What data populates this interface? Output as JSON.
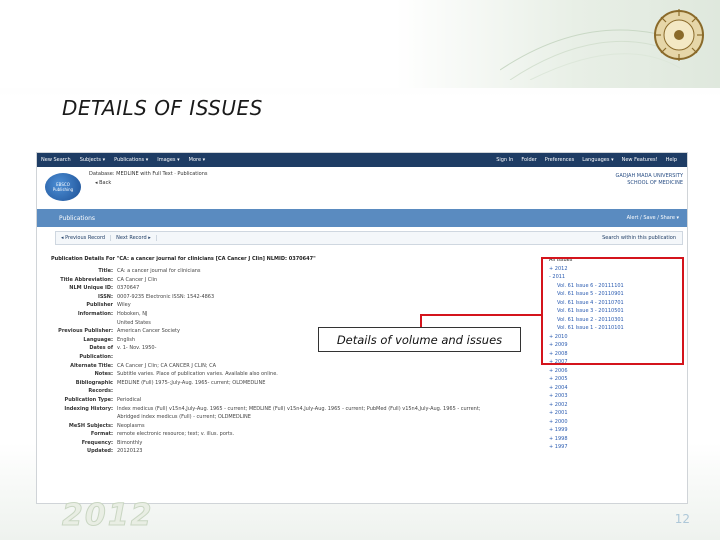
{
  "slide": {
    "title": "DETAILS OF ISSUES",
    "year": "2012",
    "page_number": "12",
    "callout_text": "Details of volume and issues",
    "colors": {
      "annotation": "#d4141c",
      "title": "#1a1a1a",
      "nav": "#1e3c64",
      "bar": "#5a8bc0"
    }
  },
  "screenshot": {
    "topnav": {
      "left": [
        "New Search",
        "Subjects ▾",
        "Publications ▾",
        "Images ▾",
        "More ▾"
      ],
      "right": [
        "Sign In",
        "Folder",
        "Preferences",
        "Languages ▾",
        "New Features!",
        "Help"
      ]
    },
    "header": {
      "logo_top": "EBSCO",
      "logo_bottom": "Publishing",
      "database_line": "Database: MEDLINE with Full Text · Publications",
      "back": "◂ Back",
      "university": [
        "GADJAH MADA UNIVERSITY",
        "SCHOOL OF MEDICINE"
      ]
    },
    "pub_bar": {
      "label": "Publications",
      "tools": "Alert / Save / Share ▾"
    },
    "pager": {
      "prev": "◂ Previous Record",
      "next": "Next Record ▸",
      "search": "Search within this publication"
    },
    "details_title": "Publication Details For \"CA: a cancer journal for clinicians [CA Cancer J Clin] NLMID: 0370647\"",
    "details": [
      {
        "label": "Title:",
        "value": "CA: a cancer journal for clinicians"
      },
      {
        "label": "Title Abbreviation:",
        "value": "CA Cancer J Clin"
      },
      {
        "label": "NLM Unique ID:",
        "value": "0370647"
      },
      {
        "label": "ISSN:",
        "value": "0007-9235 Electronic ISSN: 1542-4863"
      },
      {
        "label": "Publisher",
        "value": "Wiley"
      },
      {
        "label": "Information:",
        "value": "Hoboken, NJ"
      },
      {
        "label": "",
        "value": "United States"
      },
      {
        "label": "Previous Publisher:",
        "value": "American Cancer Society"
      },
      {
        "label": "Language:",
        "value": "English"
      },
      {
        "label": "Dates of",
        "value": "v. 1- Nov. 1950-"
      },
      {
        "label": "Publication:",
        "value": ""
      },
      {
        "label": "Alternate Title:",
        "value": "CA Cancer J Clin; CA CANCER J CLIN; CA"
      },
      {
        "label": "Notes:",
        "value": "Subtitle varies. Place of publication varies. Available also online."
      },
      {
        "label": "Bibliographic",
        "value": "MEDLINE (Full) 1975-;July-Aug. 1965- current; OLDMEDLINE"
      },
      {
        "label": "Records:",
        "value": ""
      },
      {
        "label": "Publication Type:",
        "value": "Periodical"
      },
      {
        "label": "Indexing History:",
        "value": "Index medicus (Full) v15n4,July-Aug. 1965 - current; MEDLINE (Full) v15n4,July-Aug. 1965 - current; PubMed (Full) v15n4,July-Aug. 1965 - current;"
      },
      {
        "label": "",
        "value": "Abridged index medicus (Full) - current; OLDMEDLINE"
      },
      {
        "label": "MeSH Subjects:",
        "value": "Neoplasms"
      },
      {
        "label": "Format:",
        "value": "remote electronic resource; text; v. illus. ports."
      },
      {
        "label": "Frequency:",
        "value": "Bimonthly"
      },
      {
        "label": "Updated:",
        "value": "20120123"
      }
    ],
    "issues": [
      {
        "text": "All Issues",
        "sub": false,
        "head": true
      },
      {
        "text": "+ 2012",
        "sub": false
      },
      {
        "text": "- 2011",
        "sub": false
      },
      {
        "text": "Vol. 61 Issue 6 - 20111101",
        "sub": true
      },
      {
        "text": "Vol. 61 Issue 5 - 20110901",
        "sub": true
      },
      {
        "text": "Vol. 61 Issue 4 - 20110701",
        "sub": true
      },
      {
        "text": "Vol. 61 Issue 3 - 20110501",
        "sub": true
      },
      {
        "text": "Vol. 61 Issue 2 - 20110301",
        "sub": true
      },
      {
        "text": "Vol. 61 Issue 1 - 20110101",
        "sub": true
      },
      {
        "text": "+ 2010",
        "sub": false
      },
      {
        "text": "+ 2009",
        "sub": false
      },
      {
        "text": "+ 2008",
        "sub": false
      },
      {
        "text": "+ 2007",
        "sub": false
      },
      {
        "text": "+ 2006",
        "sub": false
      },
      {
        "text": "+ 2005",
        "sub": false
      },
      {
        "text": "+ 2004",
        "sub": false
      },
      {
        "text": "+ 2003",
        "sub": false
      },
      {
        "text": "+ 2002",
        "sub": false
      },
      {
        "text": "+ 2001",
        "sub": false
      },
      {
        "text": "+ 2000",
        "sub": false
      },
      {
        "text": "+ 1999",
        "sub": false
      },
      {
        "text": "+ 1998",
        "sub": false
      },
      {
        "text": "+ 1997",
        "sub": false
      }
    ]
  }
}
